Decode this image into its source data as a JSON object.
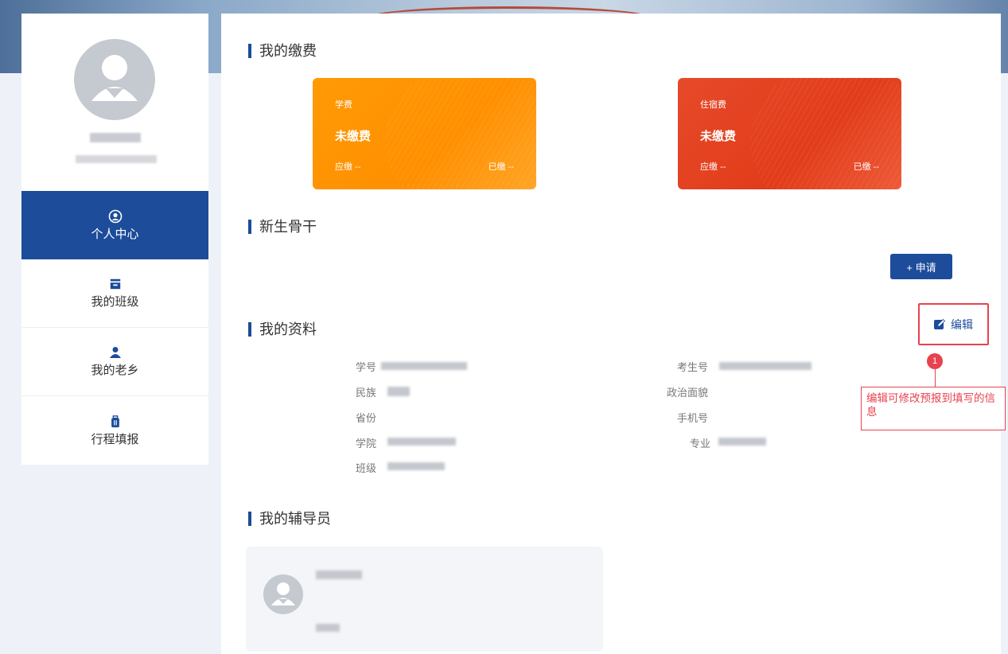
{
  "sidebar": {
    "nav": [
      {
        "label": "个人中心",
        "icon": "user-circle-icon",
        "active": true
      },
      {
        "label": "我的班级",
        "icon": "class-icon",
        "active": false
      },
      {
        "label": "我的老乡",
        "icon": "users-icon",
        "active": false
      },
      {
        "label": "行程填报",
        "icon": "luggage-icon",
        "active": false
      }
    ]
  },
  "fees": {
    "title": "我的缴费",
    "cards": [
      {
        "label": "学费",
        "status": "未缴费",
        "due": "应缴 --",
        "paid": "已缴 --",
        "color": "#ff9405"
      },
      {
        "label": "住宿费",
        "status": "未缴费",
        "due": "应缴 --",
        "paid": "已缴 --",
        "color": "#e23c1a"
      }
    ]
  },
  "backbone": {
    "title": "新生骨干",
    "apply_label": "+ 申请"
  },
  "profile": {
    "title": "我的资料",
    "edit_label": "编辑",
    "fields": {
      "student_no": "学号",
      "exam_no": "考生号",
      "ethnicity": "民族",
      "political": "政治面貌",
      "province": "省份",
      "phone": "手机号",
      "college": "学院",
      "major": "专业",
      "class": "班级"
    }
  },
  "annotation": {
    "number": "1",
    "text": "编辑可修改预报到填写的信息"
  },
  "counselor": {
    "title": "我的辅导员"
  },
  "colors": {
    "primary": "#1c4c9a",
    "highlight": "#e8424e"
  }
}
